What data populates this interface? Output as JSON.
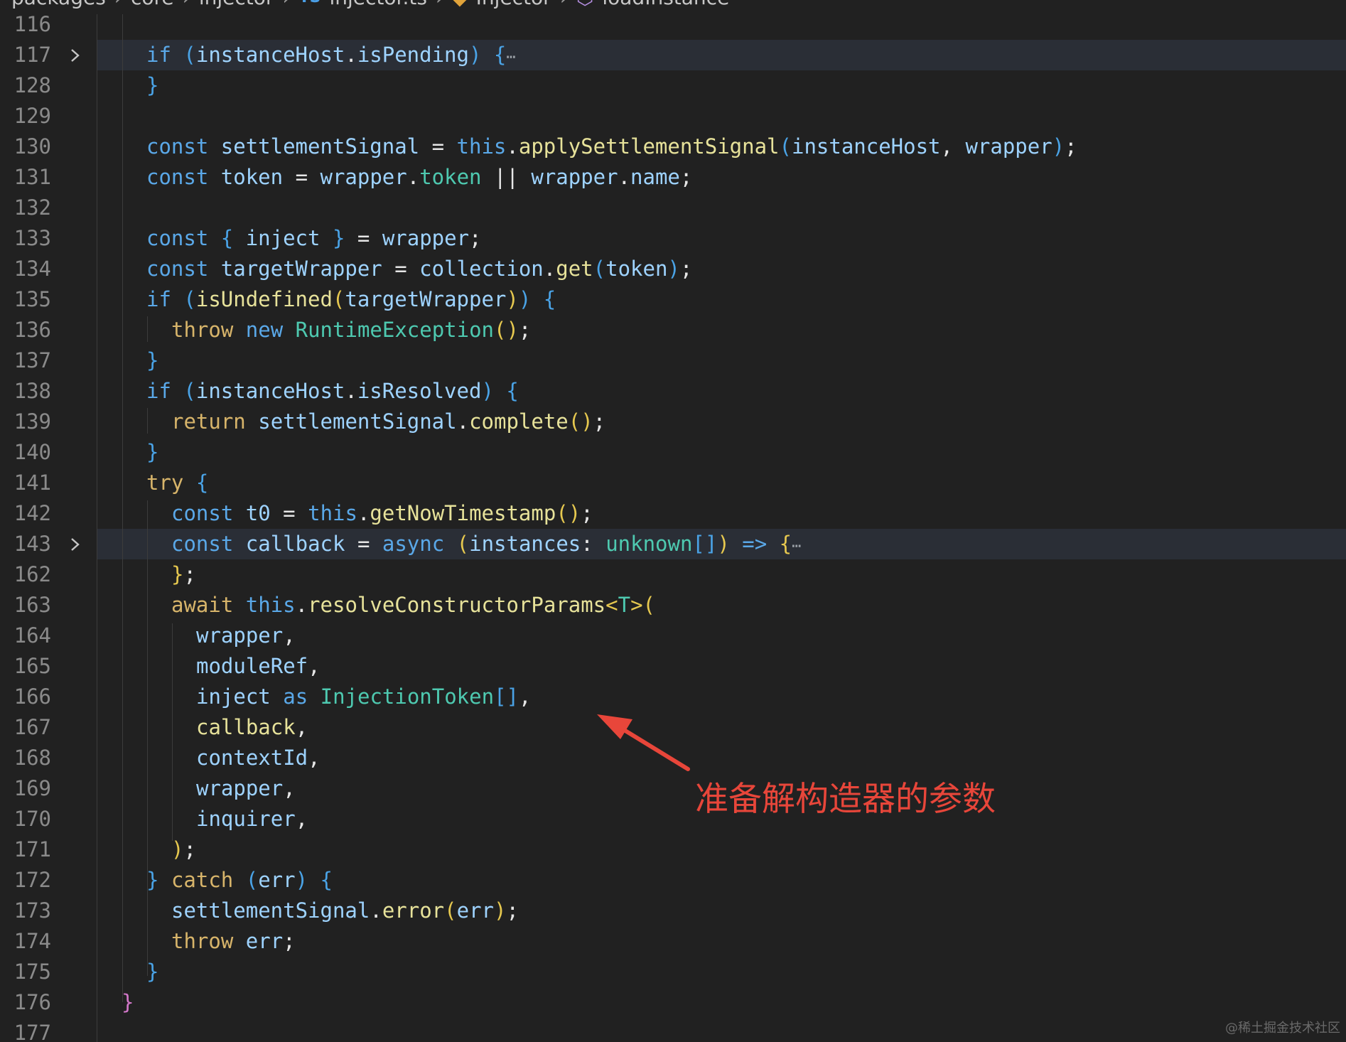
{
  "breadcrumb": {
    "items": [
      "packages",
      "core",
      "injector",
      "injector.ts",
      "Injector",
      "loadInstance"
    ],
    "icons": [
      "typescript-file-icon",
      "class-icon",
      "method-icon"
    ]
  },
  "colors": {
    "background": "#212121",
    "folded_line_background": "#2a2e36",
    "line_number": "#8a8a8a",
    "keyword": "#5aa8e8",
    "control_keyword": "#d7b46a",
    "variable": "#9ed3ff",
    "function": "#e7e29a",
    "class": "#4ec9b0",
    "annotation": "#e8463a"
  },
  "lines": [
    {
      "num": "116",
      "code": ""
    },
    {
      "num": "117",
      "code": "if (instanceHost.isPending) {⋯",
      "folded": true
    },
    {
      "num": "128",
      "code": "}"
    },
    {
      "num": "129",
      "code": ""
    },
    {
      "num": "130",
      "code": "const settlementSignal = this.applySettlementSignal(instanceHost, wrapper);"
    },
    {
      "num": "131",
      "code": "const token = wrapper.token || wrapper.name;"
    },
    {
      "num": "132",
      "code": ""
    },
    {
      "num": "133",
      "code": "const { inject } = wrapper;"
    },
    {
      "num": "134",
      "code": "const targetWrapper = collection.get(token);"
    },
    {
      "num": "135",
      "code": "if (isUndefined(targetWrapper)) {"
    },
    {
      "num": "136",
      "code": "throw new RuntimeException();"
    },
    {
      "num": "137",
      "code": "}"
    },
    {
      "num": "138",
      "code": "if (instanceHost.isResolved) {"
    },
    {
      "num": "139",
      "code": "return settlementSignal.complete();"
    },
    {
      "num": "140",
      "code": "}"
    },
    {
      "num": "141",
      "code": "try {"
    },
    {
      "num": "142",
      "code": "const t0 = this.getNowTimestamp();"
    },
    {
      "num": "143",
      "code": "const callback = async (instances: unknown[]) => {⋯",
      "folded": true
    },
    {
      "num": "162",
      "code": "};"
    },
    {
      "num": "163",
      "code": "await this.resolveConstructorParams<T>("
    },
    {
      "num": "164",
      "code": "wrapper,"
    },
    {
      "num": "165",
      "code": "moduleRef,"
    },
    {
      "num": "166",
      "code": "inject as InjectionToken[],"
    },
    {
      "num": "167",
      "code": "callback,"
    },
    {
      "num": "168",
      "code": "contextId,"
    },
    {
      "num": "169",
      "code": "wrapper,"
    },
    {
      "num": "170",
      "code": "inquirer,"
    },
    {
      "num": "171",
      "code": ");"
    },
    {
      "num": "172",
      "code": "} catch (err) {"
    },
    {
      "num": "173",
      "code": "settlementSignal.error(err);"
    },
    {
      "num": "174",
      "code": "throw err;"
    },
    {
      "num": "175",
      "code": "}"
    },
    {
      "num": "176",
      "code": "}"
    },
    {
      "num": "177",
      "code": ""
    }
  ],
  "annotation": {
    "text": "准备解构造器的参数"
  },
  "watermark": "@稀土掘金技术社区"
}
